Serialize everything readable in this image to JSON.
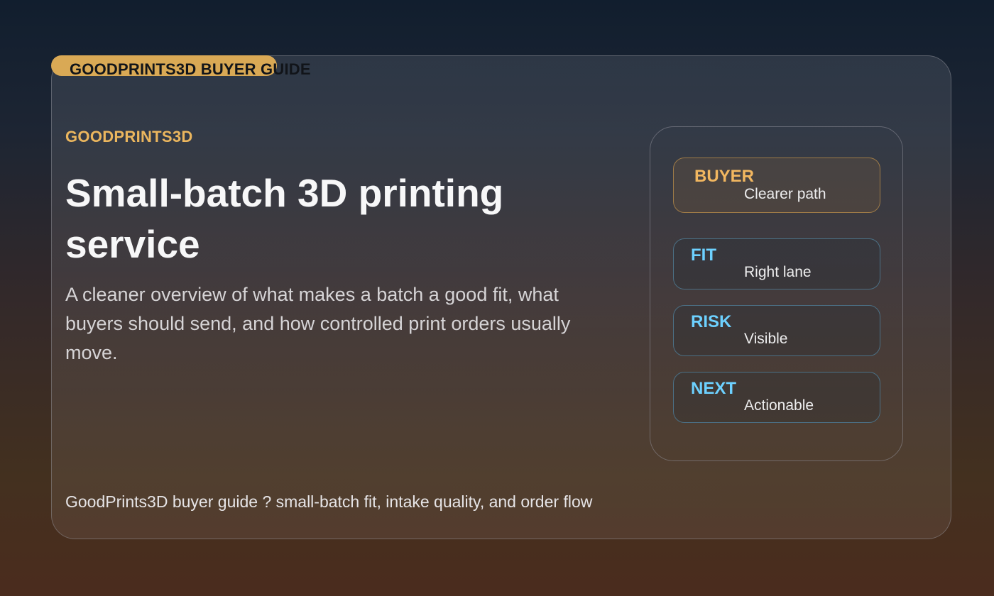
{
  "badge": {
    "label": "GOODPRINTS3D BUYER GUIDE"
  },
  "hero": {
    "brand": "GOODPRINTS3D",
    "title": "Small-batch 3D printing service",
    "subtitle": "A cleaner overview of what makes a batch a good fit, what buyers should send, and how controlled print orders usually move."
  },
  "footer": {
    "text": "GoodPrints3D buyer guide ? small-batch fit, intake quality, and order flow"
  },
  "panel": {
    "items": [
      {
        "key": "BUYER",
        "value": "Clearer path",
        "style": "gold"
      },
      {
        "key": "FIT",
        "value": "Right lane",
        "style": "blue"
      },
      {
        "key": "RISK",
        "value": "Visible",
        "style": "blue"
      },
      {
        "key": "NEXT",
        "value": "Actionable",
        "style": "blue"
      }
    ]
  },
  "colors": {
    "accent_gold": "#ebb65e",
    "accent_blue": "#6dd1ff",
    "badge_fill": "#d9a955"
  }
}
